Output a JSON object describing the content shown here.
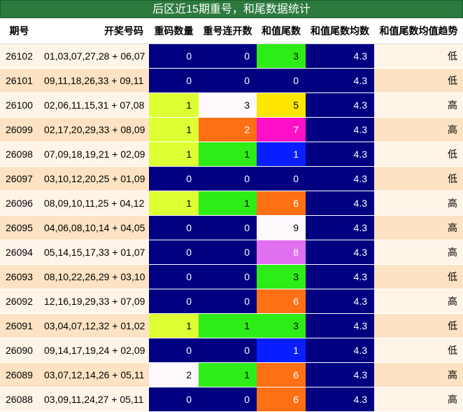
{
  "title": "后区近15期重号，和尾数据统计",
  "headers": {
    "period": "期号",
    "draw": "开奖号码",
    "repeat_count": "重码数量",
    "consecutive": "重号连开数",
    "sum_tail": "和值尾数",
    "avg": "和值尾数均数",
    "trend": "和值尾数均值趋势"
  },
  "colors": {
    "navy": "#000080",
    "lime": "#ddff33",
    "white": "#fff8fc",
    "orange": "#ff7015",
    "green": "#2eec16",
    "yellow": "#ffe600",
    "magenta": "#ff10c8",
    "blue": "#0a1fff",
    "violet": "#e070f0"
  },
  "rows": [
    {
      "period": "26102",
      "draw": "01,03,07,27,28 + 06,07",
      "repeat_count": "0",
      "repeat_bg": "navy",
      "consecutive": "0",
      "consecutive_bg": "navy",
      "sum_tail": "3",
      "sum_tail_bg": "green",
      "avg": "4.3",
      "trend": "低"
    },
    {
      "period": "26101",
      "draw": "09,11,18,26,33 + 09,11",
      "repeat_count": "0",
      "repeat_bg": "navy",
      "consecutive": "0",
      "consecutive_bg": "navy",
      "sum_tail": "0",
      "sum_tail_bg": "navy",
      "avg": "4.3",
      "trend": "低"
    },
    {
      "period": "26100",
      "draw": "02,06,11,15,31 + 07,08",
      "repeat_count": "1",
      "repeat_bg": "lime",
      "consecutive": "3",
      "consecutive_bg": "white",
      "sum_tail": "5",
      "sum_tail_bg": "yellow",
      "avg": "4.3",
      "trend": "高"
    },
    {
      "period": "26099",
      "draw": "02,17,20,29,33 + 08,09",
      "repeat_count": "1",
      "repeat_bg": "lime",
      "consecutive": "2",
      "consecutive_bg": "orange",
      "sum_tail": "7",
      "sum_tail_bg": "magenta",
      "avg": "4.3",
      "trend": "高"
    },
    {
      "period": "26098",
      "draw": "07,09,18,19,21 + 02,09",
      "repeat_count": "1",
      "repeat_bg": "lime",
      "consecutive": "1",
      "consecutive_bg": "green",
      "sum_tail": "1",
      "sum_tail_bg": "blue",
      "avg": "4.3",
      "trend": "低"
    },
    {
      "period": "26097",
      "draw": "03,10,12,20,25 + 01,09",
      "repeat_count": "0",
      "repeat_bg": "navy",
      "consecutive": "0",
      "consecutive_bg": "navy",
      "sum_tail": "0",
      "sum_tail_bg": "navy",
      "avg": "4.3",
      "trend": "低"
    },
    {
      "period": "26096",
      "draw": "08,09,10,11,25 + 04,12",
      "repeat_count": "1",
      "repeat_bg": "lime",
      "consecutive": "1",
      "consecutive_bg": "green",
      "sum_tail": "6",
      "sum_tail_bg": "orange",
      "avg": "4.3",
      "trend": "高"
    },
    {
      "period": "26095",
      "draw": "04,06,08,10,14 + 04,05",
      "repeat_count": "0",
      "repeat_bg": "navy",
      "consecutive": "0",
      "consecutive_bg": "navy",
      "sum_tail": "9",
      "sum_tail_bg": "white",
      "avg": "4.3",
      "trend": "高"
    },
    {
      "period": "26094",
      "draw": "05,14,15,17,33 + 01,07",
      "repeat_count": "0",
      "repeat_bg": "navy",
      "consecutive": "0",
      "consecutive_bg": "navy",
      "sum_tail": "8",
      "sum_tail_bg": "violet",
      "avg": "4.3",
      "trend": "高"
    },
    {
      "period": "26093",
      "draw": "08,10,22,26,29 + 03,10",
      "repeat_count": "0",
      "repeat_bg": "navy",
      "consecutive": "0",
      "consecutive_bg": "navy",
      "sum_tail": "3",
      "sum_tail_bg": "green",
      "avg": "4.3",
      "trend": "低"
    },
    {
      "period": "26092",
      "draw": "12,16,19,29,33 + 07,09",
      "repeat_count": "0",
      "repeat_bg": "navy",
      "consecutive": "0",
      "consecutive_bg": "navy",
      "sum_tail": "6",
      "sum_tail_bg": "orange",
      "avg": "4.3",
      "trend": "高"
    },
    {
      "period": "26091",
      "draw": "03,04,07,12,32 + 01,02",
      "repeat_count": "1",
      "repeat_bg": "lime",
      "consecutive": "1",
      "consecutive_bg": "green",
      "sum_tail": "3",
      "sum_tail_bg": "green",
      "avg": "4.3",
      "trend": "低"
    },
    {
      "period": "26090",
      "draw": "09,14,17,19,24 + 02,09",
      "repeat_count": "0",
      "repeat_bg": "navy",
      "consecutive": "0",
      "consecutive_bg": "navy",
      "sum_tail": "1",
      "sum_tail_bg": "blue",
      "avg": "4.3",
      "trend": "低"
    },
    {
      "period": "26089",
      "draw": "03,07,12,14,26 + 05,11",
      "repeat_count": "2",
      "repeat_bg": "white",
      "consecutive": "1",
      "consecutive_bg": "green",
      "sum_tail": "6",
      "sum_tail_bg": "orange",
      "avg": "4.3",
      "trend": "高"
    },
    {
      "period": "26088",
      "draw": "03,09,11,24,27 + 05,11",
      "repeat_count": "0",
      "repeat_bg": "navy",
      "consecutive": "0",
      "consecutive_bg": "navy",
      "sum_tail": "6",
      "sum_tail_bg": "orange",
      "avg": "4.3",
      "trend": "高"
    }
  ]
}
